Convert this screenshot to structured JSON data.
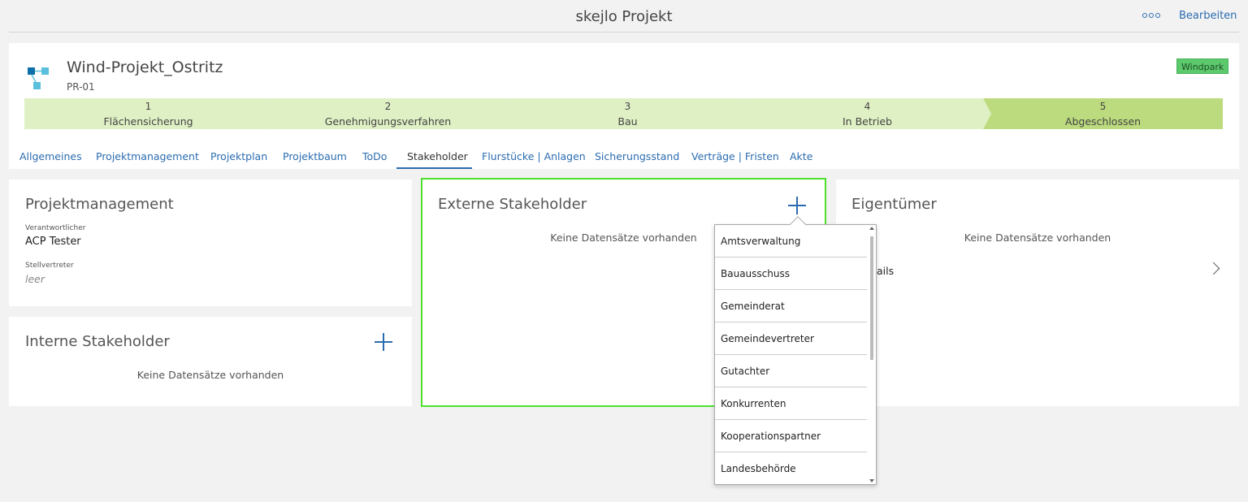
{
  "app": {
    "title": "skejlo Projekt",
    "more_icon": "more-circles-icon",
    "edit_label": "Bearbeiten"
  },
  "project": {
    "name": "Wind-Projekt_Ostritz",
    "id": "PR-01",
    "type_badge": "Windpark",
    "icon": "hierarchy-icon"
  },
  "stages": [
    {
      "num": "1",
      "label": "Flächensicherung"
    },
    {
      "num": "2",
      "label": "Genehmigungsverfahren"
    },
    {
      "num": "3",
      "label": "Bau"
    },
    {
      "num": "4",
      "label": "In Betrieb"
    },
    {
      "num": "5",
      "label": "Abgeschlossen"
    }
  ],
  "tabs": [
    "Allgemeines",
    "Projektmanagement",
    "Projektplan",
    "Projektbaum",
    "ToDo",
    "Stakeholder",
    "Flurstücke | Anlagen",
    "Sicherungsstand",
    "Verträge | Fristen",
    "Akte"
  ],
  "active_tab": "Stakeholder",
  "projektmanagement": {
    "title": "Projektmanagement",
    "responsible_label": "Verantwortlicher",
    "responsible_value": "ACP Tester",
    "deputy_label": "Stellvertreter",
    "deputy_value": "leer"
  },
  "interne": {
    "title": "Interne Stakeholder",
    "empty": "Keine Datensätze vorhanden"
  },
  "externe": {
    "title": "Externe Stakeholder",
    "empty": "Keine Datensätze vorhanden"
  },
  "eigentuemer": {
    "title": "Eigentümer",
    "empty": "Keine Datensätze vorhanden",
    "details_partial": "ails"
  },
  "dropdown": {
    "items": [
      "Amtsverwaltung",
      "Bauausschuss",
      "Gemeinderat",
      "Gemeindevertreter",
      "Gutachter",
      "Konkurrenten",
      "Kooperationspartner",
      "Landesbehörde"
    ]
  },
  "colors": {
    "accent": "#2b6cb0",
    "stage": "#dff0c4",
    "stage_active": "#bcdb7e",
    "badge": "#5cc96d",
    "focus_border": "#4ee12b"
  }
}
